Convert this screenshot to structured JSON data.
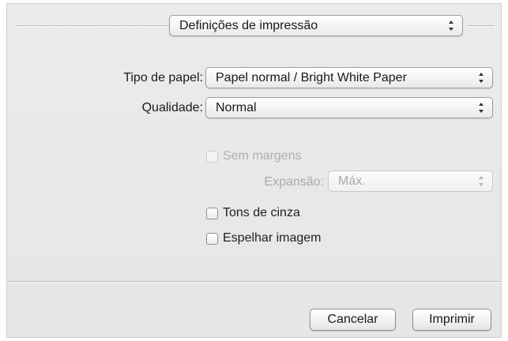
{
  "header": {
    "section_popup": "Definições de impressão"
  },
  "settings": {
    "paper_type_label": "Tipo de papel:",
    "paper_type_value": "Papel normal / Bright White Paper",
    "quality_label": "Qualidade:",
    "quality_value": "Normal"
  },
  "options": {
    "borderless_label": "Sem margens",
    "expansion_label": "Expansão:",
    "expansion_value": "Máx.",
    "grayscale_label": "Tons de cinza",
    "mirror_label": "Espelhar imagem"
  },
  "footer": {
    "cancel_label": "Cancelar",
    "print_label": "Imprimir"
  },
  "icons": {
    "popup_arrows": "up-down-arrows-icon"
  }
}
